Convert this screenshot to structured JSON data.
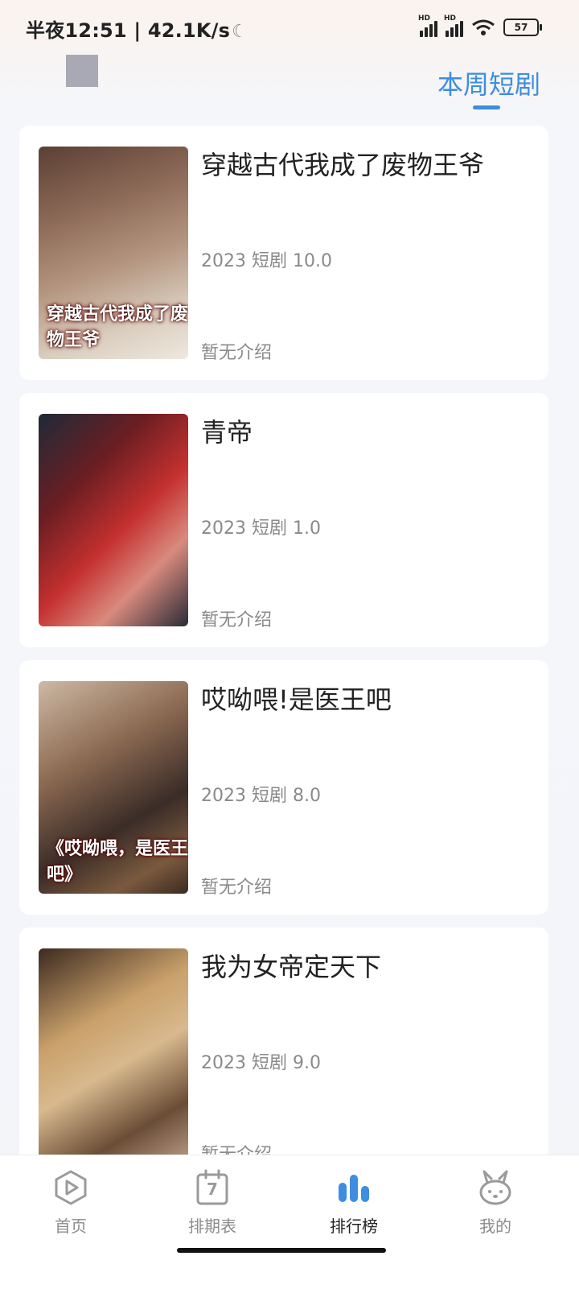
{
  "status_bar": {
    "time_net": "半夜12:51 | 42.1K/s",
    "signal1_label": "HD",
    "signal2_label": "HD",
    "battery": "57",
    "icons": [
      "moon-icon",
      "signal-icon",
      "wifi-icon",
      "battery-icon"
    ]
  },
  "header": {
    "tab_label": "本周短剧"
  },
  "items": [
    {
      "title": "穿越古代我成了废物王爷",
      "meta": "2023 短剧 10.0",
      "desc": "暂无介绍",
      "poster_text": "穿越古代我成了废物王爷"
    },
    {
      "title": "青帝",
      "meta": "2023 短剧 1.0",
      "desc": "暂无介绍"
    },
    {
      "title": "哎呦喂!是医王吧",
      "meta": "2023 短剧 8.0",
      "desc": "暂无介绍",
      "poster_text": "《哎呦喂，是医王吧》"
    },
    {
      "title": "我为女帝定天下",
      "meta": "2023 短剧 9.0",
      "desc": "暂无介绍"
    }
  ],
  "bottom_nav": {
    "items": [
      {
        "label": "首页",
        "icon": "play-icon"
      },
      {
        "label": "排期表",
        "icon": "calendar-icon",
        "calendar_day": "7"
      },
      {
        "label": "排行榜",
        "icon": "ranking-icon",
        "active": true
      },
      {
        "label": "我的",
        "icon": "rabbit-icon"
      }
    ]
  },
  "colors": {
    "accent": "#3d8de0",
    "text_muted": "#8a8a8a"
  }
}
